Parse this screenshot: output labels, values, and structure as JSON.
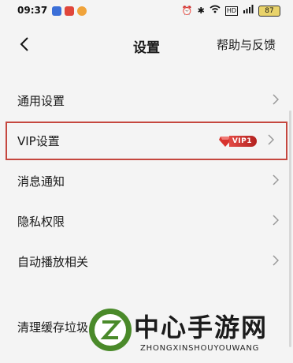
{
  "status_bar": {
    "time": "09:37",
    "battery": "87",
    "icons": [
      "alarm-icon",
      "bluetooth-icon",
      "wifi-icon",
      "hd-icon",
      "signal-icon"
    ]
  },
  "nav": {
    "title": "设置",
    "help": "帮助与反馈"
  },
  "settings": [
    {
      "label": "通用设置"
    },
    {
      "label": "VIP设置",
      "badge": "VIP1"
    },
    {
      "label": "消息通知"
    },
    {
      "label": "隐私权限"
    },
    {
      "label": "自动播放相关"
    }
  ],
  "clear_cache": "清理缓存垃圾",
  "watermark": {
    "name": "中心手游网",
    "pinyin": "ZHONGXINSHOUYOUWANG"
  },
  "colors": {
    "highlight_border": "#c5473f",
    "vip_red": "#d8332e",
    "logo_green": "#4a8a2a"
  }
}
